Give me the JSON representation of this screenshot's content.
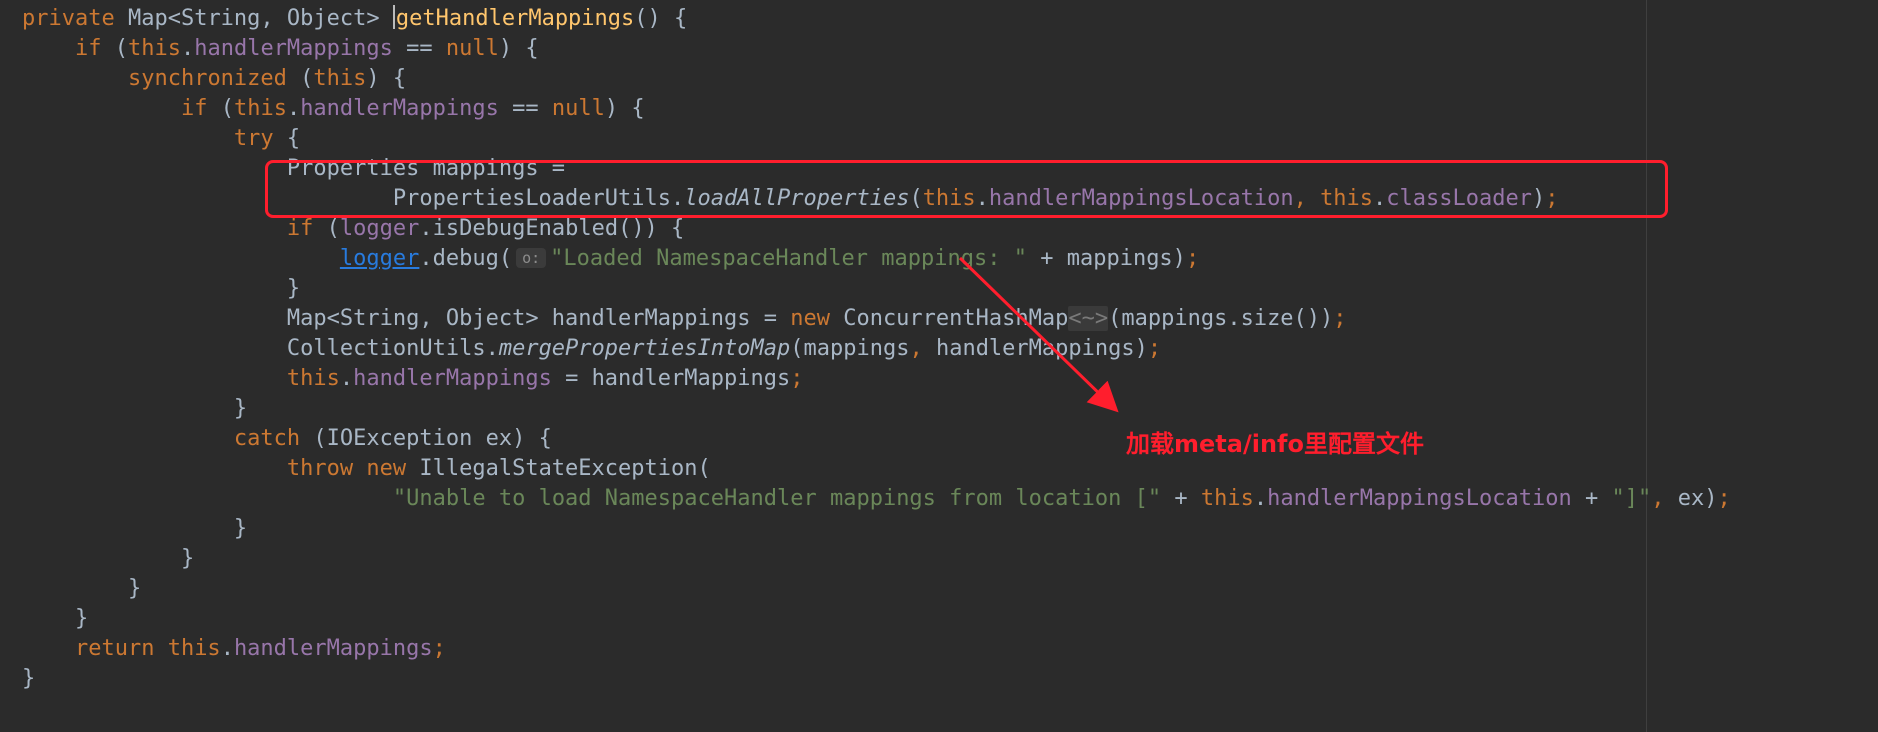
{
  "code_lines": [
    [
      {
        "t": "private ",
        "c": "kw"
      },
      {
        "t": "Map<String, Object> "
      },
      {
        "caret": true
      },
      {
        "t": "getHandlerMappings",
        "c": "fn"
      },
      {
        "t": "() {"
      }
    ],
    [
      {
        "t": "    "
      },
      {
        "t": "if ",
        "c": "kw"
      },
      {
        "t": "("
      },
      {
        "t": "this",
        "c": "kw"
      },
      {
        "t": "."
      },
      {
        "t": "handlerMappings",
        "c": "fld"
      },
      {
        "t": " == "
      },
      {
        "t": "null",
        "c": "kw"
      },
      {
        "t": ") {"
      }
    ],
    [
      {
        "t": "        "
      },
      {
        "t": "synchronized ",
        "c": "kw"
      },
      {
        "t": "("
      },
      {
        "t": "this",
        "c": "kw"
      },
      {
        "t": ") {"
      }
    ],
    [
      {
        "t": "            "
      },
      {
        "t": "if ",
        "c": "kw"
      },
      {
        "t": "("
      },
      {
        "t": "this",
        "c": "kw"
      },
      {
        "t": "."
      },
      {
        "t": "handlerMappings",
        "c": "fld"
      },
      {
        "t": " == "
      },
      {
        "t": "null",
        "c": "kw"
      },
      {
        "t": ") {"
      }
    ],
    [
      {
        "t": "                "
      },
      {
        "t": "try ",
        "c": "kw"
      },
      {
        "t": "{"
      }
    ],
    [
      {
        "t": "                    Properties mappings ="
      }
    ],
    [
      {
        "t": "                            PropertiesLoaderUtils."
      },
      {
        "t": "loadAllProperties",
        "c": "ital"
      },
      {
        "t": "("
      },
      {
        "t": "this",
        "c": "kw"
      },
      {
        "t": "."
      },
      {
        "t": "handlerMappingsLocation",
        "c": "fld"
      },
      {
        "t": ", ",
        "c": "kw"
      },
      {
        "t": "this",
        "c": "kw"
      },
      {
        "t": "."
      },
      {
        "t": "classLoader",
        "c": "fld"
      },
      {
        "t": ")"
      },
      {
        "t": ";",
        "c": "kw"
      }
    ],
    [
      {
        "t": "                    "
      },
      {
        "t": "if ",
        "c": "kw"
      },
      {
        "t": "("
      },
      {
        "t": "logger",
        "c": "fld"
      },
      {
        "t": ".isDebugEnabled()) {"
      }
    ],
    [
      {
        "t": "                        "
      },
      {
        "t": "logger",
        "c": "link"
      },
      {
        "t": ".debug("
      },
      {
        "hint": "o:"
      },
      {
        "t": "\"Loaded NamespaceHandler mappings: \"",
        "c": "str"
      },
      {
        "t": " + mappings)"
      },
      {
        "t": ";",
        "c": "kw"
      }
    ],
    [
      {
        "t": "                    }"
      }
    ],
    [
      {
        "t": "                    Map<String, Object> handlerMappings = "
      },
      {
        "t": "new ",
        "c": "kw"
      },
      {
        "t": "ConcurrentHashMap"
      },
      {
        "t": "<~>",
        "c": "fold"
      },
      {
        "t": "(mappings.size())"
      },
      {
        "t": ";",
        "c": "kw"
      }
    ],
    [
      {
        "t": "                    CollectionUtils."
      },
      {
        "t": "mergePropertiesIntoMap",
        "c": "ital"
      },
      {
        "t": "(mappings"
      },
      {
        "t": ", ",
        "c": "kw"
      },
      {
        "t": "handlerMappings)"
      },
      {
        "t": ";",
        "c": "kw"
      }
    ],
    [
      {
        "t": "                    "
      },
      {
        "t": "this",
        "c": "kw"
      },
      {
        "t": "."
      },
      {
        "t": "handlerMappings",
        "c": "fld"
      },
      {
        "t": " = handlerMappings"
      },
      {
        "t": ";",
        "c": "kw"
      }
    ],
    [
      {
        "t": "                }"
      }
    ],
    [
      {
        "t": "                "
      },
      {
        "t": "catch ",
        "c": "kw"
      },
      {
        "t": "(IOException ex) {"
      }
    ],
    [
      {
        "t": "                    "
      },
      {
        "t": "throw new ",
        "c": "kw"
      },
      {
        "t": "IllegalStateException("
      }
    ],
    [
      {
        "t": "                            "
      },
      {
        "t": "\"Unable to load NamespaceHandler mappings from location [\"",
        "c": "str"
      },
      {
        "t": " + "
      },
      {
        "t": "this",
        "c": "kw"
      },
      {
        "t": "."
      },
      {
        "t": "handlerMappingsLocation",
        "c": "fld"
      },
      {
        "t": " + "
      },
      {
        "t": "\"]\"",
        "c": "str"
      },
      {
        "t": ", ",
        "c": "kw"
      },
      {
        "t": "ex)"
      },
      {
        "t": ";",
        "c": "kw"
      }
    ],
    [
      {
        "t": "                }"
      }
    ],
    [
      {
        "t": "            }"
      }
    ],
    [
      {
        "t": "        }"
      }
    ],
    [
      {
        "t": "    }"
      }
    ],
    [
      {
        "t": "    "
      },
      {
        "t": "return this",
        "c": "kw"
      },
      {
        "t": "."
      },
      {
        "t": "handlerMappings",
        "c": "fld"
      },
      {
        "t": ";",
        "c": "kw"
      }
    ],
    [
      {
        "t": "}"
      }
    ]
  ],
  "annotation": {
    "text": "加载meta/info里配置文件"
  },
  "colors": {
    "background": "#2b2b2b",
    "default_text": "#a9b7c6",
    "keyword": "#cc7832",
    "method_decl": "#ffc66d",
    "field": "#9876aa",
    "string": "#6a8759",
    "link": "#287bde",
    "annotation_red": "#ff1e2d"
  }
}
